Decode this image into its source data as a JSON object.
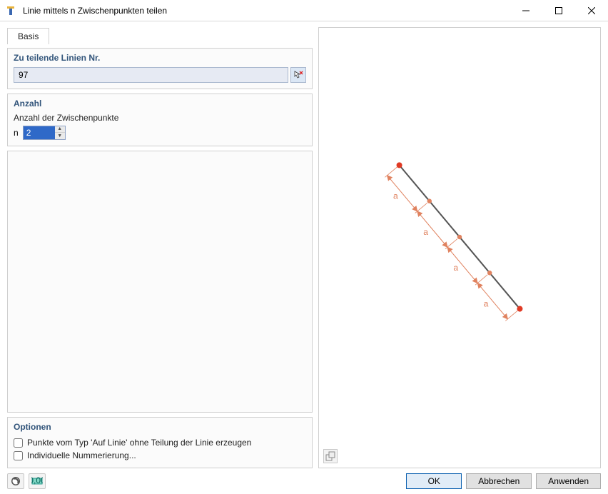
{
  "window": {
    "title": "Linie mittels n Zwischenpunkten teilen"
  },
  "tabs": {
    "basis": "Basis"
  },
  "sections": {
    "lines_to_split": {
      "heading": "Zu teilende Linien Nr.",
      "value": "97"
    },
    "count": {
      "heading": "Anzahl",
      "label": "Anzahl der Zwischenpunkte",
      "prefix": "n",
      "value": "2"
    },
    "options": {
      "heading": "Optionen",
      "opt_on_line": "Punkte vom Typ 'Auf Linie' ohne Teilung der Linie erzeugen",
      "opt_numbering": "Individuelle Nummerierung..."
    }
  },
  "preview": {
    "segment_label": "a"
  },
  "buttons": {
    "ok": "OK",
    "cancel": "Abbrechen",
    "apply": "Anwenden"
  }
}
